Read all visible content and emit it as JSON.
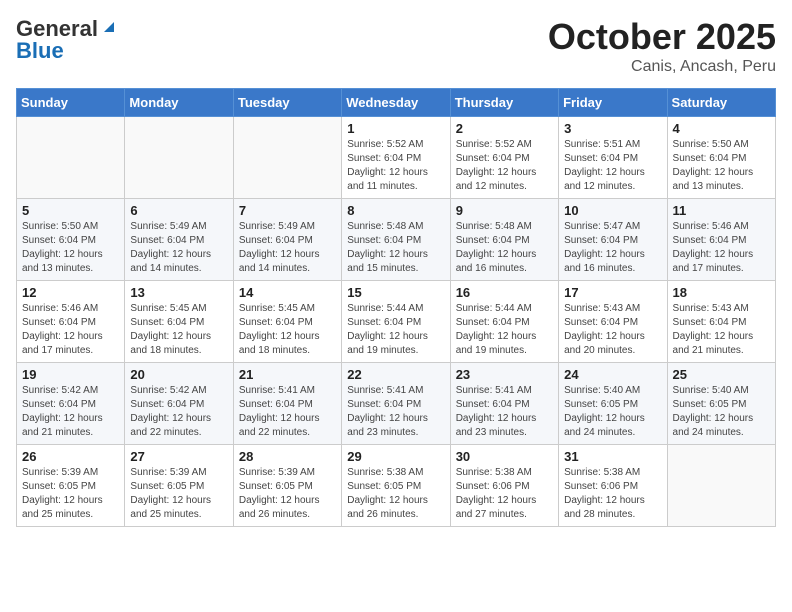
{
  "logo": {
    "general": "General",
    "blue": "Blue"
  },
  "title": "October 2025",
  "subtitle": "Canis, Ancash, Peru",
  "weekdays": [
    "Sunday",
    "Monday",
    "Tuesday",
    "Wednesday",
    "Thursday",
    "Friday",
    "Saturday"
  ],
  "weeks": [
    [
      {
        "day": "",
        "info": ""
      },
      {
        "day": "",
        "info": ""
      },
      {
        "day": "",
        "info": ""
      },
      {
        "day": "1",
        "info": "Sunrise: 5:52 AM\nSunset: 6:04 PM\nDaylight: 12 hours\nand 11 minutes."
      },
      {
        "day": "2",
        "info": "Sunrise: 5:52 AM\nSunset: 6:04 PM\nDaylight: 12 hours\nand 12 minutes."
      },
      {
        "day": "3",
        "info": "Sunrise: 5:51 AM\nSunset: 6:04 PM\nDaylight: 12 hours\nand 12 minutes."
      },
      {
        "day": "4",
        "info": "Sunrise: 5:50 AM\nSunset: 6:04 PM\nDaylight: 12 hours\nand 13 minutes."
      }
    ],
    [
      {
        "day": "5",
        "info": "Sunrise: 5:50 AM\nSunset: 6:04 PM\nDaylight: 12 hours\nand 13 minutes."
      },
      {
        "day": "6",
        "info": "Sunrise: 5:49 AM\nSunset: 6:04 PM\nDaylight: 12 hours\nand 14 minutes."
      },
      {
        "day": "7",
        "info": "Sunrise: 5:49 AM\nSunset: 6:04 PM\nDaylight: 12 hours\nand 14 minutes."
      },
      {
        "day": "8",
        "info": "Sunrise: 5:48 AM\nSunset: 6:04 PM\nDaylight: 12 hours\nand 15 minutes."
      },
      {
        "day": "9",
        "info": "Sunrise: 5:48 AM\nSunset: 6:04 PM\nDaylight: 12 hours\nand 16 minutes."
      },
      {
        "day": "10",
        "info": "Sunrise: 5:47 AM\nSunset: 6:04 PM\nDaylight: 12 hours\nand 16 minutes."
      },
      {
        "day": "11",
        "info": "Sunrise: 5:46 AM\nSunset: 6:04 PM\nDaylight: 12 hours\nand 17 minutes."
      }
    ],
    [
      {
        "day": "12",
        "info": "Sunrise: 5:46 AM\nSunset: 6:04 PM\nDaylight: 12 hours\nand 17 minutes."
      },
      {
        "day": "13",
        "info": "Sunrise: 5:45 AM\nSunset: 6:04 PM\nDaylight: 12 hours\nand 18 minutes."
      },
      {
        "day": "14",
        "info": "Sunrise: 5:45 AM\nSunset: 6:04 PM\nDaylight: 12 hours\nand 18 minutes."
      },
      {
        "day": "15",
        "info": "Sunrise: 5:44 AM\nSunset: 6:04 PM\nDaylight: 12 hours\nand 19 minutes."
      },
      {
        "day": "16",
        "info": "Sunrise: 5:44 AM\nSunset: 6:04 PM\nDaylight: 12 hours\nand 19 minutes."
      },
      {
        "day": "17",
        "info": "Sunrise: 5:43 AM\nSunset: 6:04 PM\nDaylight: 12 hours\nand 20 minutes."
      },
      {
        "day": "18",
        "info": "Sunrise: 5:43 AM\nSunset: 6:04 PM\nDaylight: 12 hours\nand 21 minutes."
      }
    ],
    [
      {
        "day": "19",
        "info": "Sunrise: 5:42 AM\nSunset: 6:04 PM\nDaylight: 12 hours\nand 21 minutes."
      },
      {
        "day": "20",
        "info": "Sunrise: 5:42 AM\nSunset: 6:04 PM\nDaylight: 12 hours\nand 22 minutes."
      },
      {
        "day": "21",
        "info": "Sunrise: 5:41 AM\nSunset: 6:04 PM\nDaylight: 12 hours\nand 22 minutes."
      },
      {
        "day": "22",
        "info": "Sunrise: 5:41 AM\nSunset: 6:04 PM\nDaylight: 12 hours\nand 23 minutes."
      },
      {
        "day": "23",
        "info": "Sunrise: 5:41 AM\nSunset: 6:04 PM\nDaylight: 12 hours\nand 23 minutes."
      },
      {
        "day": "24",
        "info": "Sunrise: 5:40 AM\nSunset: 6:05 PM\nDaylight: 12 hours\nand 24 minutes."
      },
      {
        "day": "25",
        "info": "Sunrise: 5:40 AM\nSunset: 6:05 PM\nDaylight: 12 hours\nand 24 minutes."
      }
    ],
    [
      {
        "day": "26",
        "info": "Sunrise: 5:39 AM\nSunset: 6:05 PM\nDaylight: 12 hours\nand 25 minutes."
      },
      {
        "day": "27",
        "info": "Sunrise: 5:39 AM\nSunset: 6:05 PM\nDaylight: 12 hours\nand 25 minutes."
      },
      {
        "day": "28",
        "info": "Sunrise: 5:39 AM\nSunset: 6:05 PM\nDaylight: 12 hours\nand 26 minutes."
      },
      {
        "day": "29",
        "info": "Sunrise: 5:38 AM\nSunset: 6:05 PM\nDaylight: 12 hours\nand 26 minutes."
      },
      {
        "day": "30",
        "info": "Sunrise: 5:38 AM\nSunset: 6:06 PM\nDaylight: 12 hours\nand 27 minutes."
      },
      {
        "day": "31",
        "info": "Sunrise: 5:38 AM\nSunset: 6:06 PM\nDaylight: 12 hours\nand 28 minutes."
      },
      {
        "day": "",
        "info": ""
      }
    ]
  ]
}
